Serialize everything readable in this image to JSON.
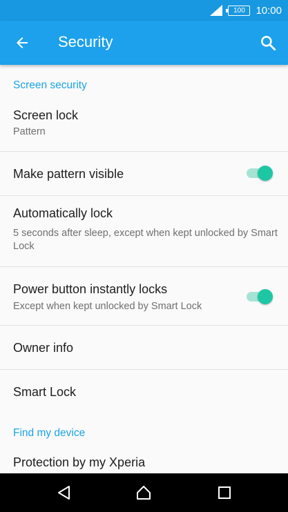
{
  "status_bar": {
    "battery": "100",
    "time": "10:00"
  },
  "app_bar": {
    "title": "Security",
    "back_icon": "arrow-back-icon",
    "search_icon": "search-icon"
  },
  "sections": [
    {
      "header": "Screen security"
    },
    {
      "header": "Find my device"
    }
  ],
  "items": {
    "screen_lock": {
      "title": "Screen lock",
      "subtitle": "Pattern"
    },
    "make_pattern_visible": {
      "title": "Make pattern visible",
      "toggle_on": true
    },
    "automatically_lock": {
      "title": "Automatically lock",
      "subtitle": "5 seconds after sleep, except when kept unlocked by Smart Lock"
    },
    "power_button": {
      "title": "Power button instantly locks",
      "subtitle": "Except when kept unlocked by Smart Lock",
      "toggle_on": true
    },
    "owner_info": {
      "title": "Owner info"
    },
    "smart_lock": {
      "title": "Smart Lock"
    },
    "protection": {
      "title": "Protection by my Xperia"
    }
  },
  "nav_bar": {
    "back": "nav-back-icon",
    "home": "nav-home-icon",
    "recents": "nav-recents-icon"
  },
  "colors": {
    "status_bar": "#1898e0",
    "app_bar": "#1da1ec",
    "accent": "#1ba4e4",
    "toggle": "#1ec7a4",
    "toggle_track": "#a6e3d5"
  }
}
